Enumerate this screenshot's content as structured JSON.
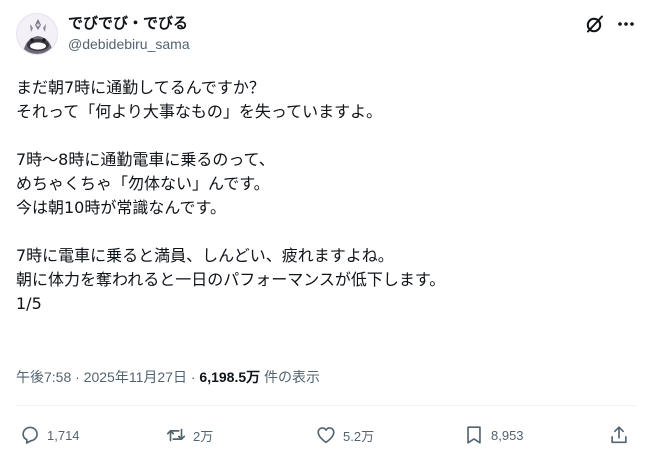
{
  "author": {
    "display_name": "でびでび・でびる",
    "handle": "@debidebiru_sama"
  },
  "post": {
    "lines": [
      "まだ朝7時に通勤してるんですか？",
      "それって「何より大事なもの」を失っていますよ。",
      "",
      "7時〜8時に通勤電車に乗るのって、",
      "めちゃくちゃ「勿体ない」んです。",
      "今は朝10時が常識なんです。",
      "",
      "7時に電車に乗ると満員、しんどい、疲れますよね。",
      "朝に体力を奪われると一日のパフォーマンスが低下します。",
      "1/5"
    ]
  },
  "meta": {
    "time": "午後7:58",
    "separator": "·",
    "date": "2025年11月27日",
    "views_count": "6,198.5万",
    "views_label": "件の表示"
  },
  "actions": {
    "replies": "1,714",
    "reposts": "2万",
    "likes": "5.2万",
    "bookmarks": "8,953"
  },
  "icons": [
    "grok-icon",
    "more-icon",
    "reply-icon",
    "repost-icon",
    "like-icon",
    "bookmark-icon",
    "share-icon"
  ],
  "colors": {
    "text": "#0f1419",
    "secondary": "#536471",
    "divider": "#eff3f4",
    "background": "#ffffff"
  }
}
